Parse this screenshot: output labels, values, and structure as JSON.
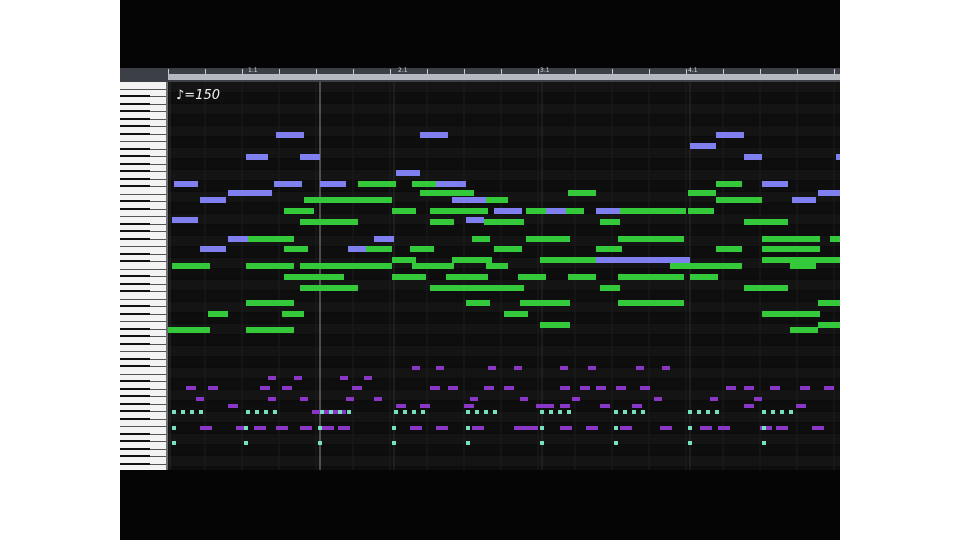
{
  "app": {
    "tempo_label": "♪=150"
  },
  "measure_labels": [
    "1.1",
    "2.1",
    "3.1",
    "4.1"
  ],
  "colors": {
    "melody": "#7f7ff0",
    "chords": "#34c93a",
    "bass": "#8a37c8",
    "drums": "#77e0c0"
  },
  "notes": {
    "melody": [
      [
        276,
        132,
        28,
        6
      ],
      [
        420,
        132,
        28,
        6
      ],
      [
        716,
        132,
        28,
        6
      ],
      [
        246,
        154,
        22,
        6
      ],
      [
        300,
        154,
        20,
        6
      ],
      [
        690,
        143,
        26,
        6
      ],
      [
        744,
        154,
        18,
        6
      ],
      [
        836,
        154,
        6,
        6
      ],
      [
        174,
        181,
        24,
        6
      ],
      [
        274,
        181,
        28,
        6
      ],
      [
        320,
        181,
        26,
        6
      ],
      [
        396,
        170,
        24,
        6
      ],
      [
        436,
        181,
        30,
        6
      ],
      [
        762,
        181,
        26,
        6
      ],
      [
        200,
        197,
        26,
        6
      ],
      [
        228,
        190,
        44,
        6
      ],
      [
        452,
        197,
        34,
        6
      ],
      [
        494,
        208,
        28,
        6
      ],
      [
        546,
        208,
        20,
        6
      ],
      [
        596,
        208,
        24,
        6
      ],
      [
        792,
        197,
        24,
        6
      ],
      [
        818,
        190,
        22,
        6
      ],
      [
        172,
        217,
        26,
        6
      ],
      [
        466,
        217,
        18,
        6
      ],
      [
        228,
        236,
        20,
        6
      ],
      [
        374,
        236,
        20,
        6
      ],
      [
        200,
        246,
        26,
        6
      ],
      [
        348,
        246,
        18,
        6
      ],
      [
        596,
        257,
        94,
        6
      ]
    ],
    "chords": [
      [
        358,
        181,
        38,
        6
      ],
      [
        412,
        181,
        26,
        6
      ],
      [
        716,
        181,
        26,
        6
      ],
      [
        304,
        197,
        88,
        6
      ],
      [
        420,
        190,
        54,
        6
      ],
      [
        474,
        197,
        34,
        6
      ],
      [
        568,
        190,
        28,
        6
      ],
      [
        688,
        190,
        28,
        6
      ],
      [
        716,
        197,
        46,
        6
      ],
      [
        284,
        208,
        30,
        6
      ],
      [
        392,
        208,
        24,
        6
      ],
      [
        430,
        208,
        58,
        6
      ],
      [
        526,
        208,
        58,
        6
      ],
      [
        598,
        208,
        88,
        6
      ],
      [
        688,
        208,
        26,
        6
      ],
      [
        300,
        219,
        58,
        6
      ],
      [
        430,
        219,
        24,
        6
      ],
      [
        484,
        219,
        40,
        6
      ],
      [
        600,
        219,
        20,
        6
      ],
      [
        744,
        219,
        18,
        6
      ],
      [
        762,
        219,
        26,
        6
      ],
      [
        246,
        236,
        48,
        6
      ],
      [
        472,
        236,
        18,
        6
      ],
      [
        526,
        236,
        44,
        6
      ],
      [
        618,
        236,
        66,
        6
      ],
      [
        762,
        236,
        58,
        6
      ],
      [
        284,
        246,
        24,
        6
      ],
      [
        348,
        246,
        44,
        6
      ],
      [
        410,
        246,
        24,
        6
      ],
      [
        494,
        246,
        28,
        6
      ],
      [
        596,
        246,
        26,
        6
      ],
      [
        716,
        246,
        26,
        6
      ],
      [
        762,
        246,
        58,
        6
      ],
      [
        830,
        236,
        12,
        6
      ],
      [
        172,
        263,
        38,
        6
      ],
      [
        246,
        263,
        48,
        6
      ],
      [
        300,
        263,
        92,
        6
      ],
      [
        392,
        257,
        24,
        6
      ],
      [
        412,
        263,
        42,
        6
      ],
      [
        452,
        257,
        40,
        6
      ],
      [
        486,
        263,
        22,
        6
      ],
      [
        540,
        257,
        56,
        6
      ],
      [
        670,
        263,
        46,
        6
      ],
      [
        716,
        263,
        26,
        6
      ],
      [
        762,
        257,
        58,
        6
      ],
      [
        790,
        263,
        26,
        6
      ],
      [
        818,
        257,
        24,
        6
      ],
      [
        284,
        274,
        20,
        6
      ],
      [
        304,
        274,
        40,
        6
      ],
      [
        392,
        274,
        34,
        6
      ],
      [
        446,
        274,
        42,
        6
      ],
      [
        518,
        274,
        28,
        6
      ],
      [
        568,
        274,
        28,
        6
      ],
      [
        618,
        274,
        66,
        6
      ],
      [
        690,
        274,
        28,
        6
      ],
      [
        300,
        285,
        58,
        6
      ],
      [
        430,
        285,
        58,
        6
      ],
      [
        484,
        285,
        40,
        6
      ],
      [
        600,
        285,
        20,
        6
      ],
      [
        744,
        285,
        18,
        6
      ],
      [
        762,
        285,
        26,
        6
      ],
      [
        246,
        300,
        48,
        6
      ],
      [
        466,
        300,
        24,
        6
      ],
      [
        520,
        300,
        50,
        6
      ],
      [
        618,
        300,
        66,
        6
      ],
      [
        818,
        300,
        22,
        6
      ],
      [
        208,
        311,
        20,
        6
      ],
      [
        282,
        311,
        22,
        6
      ],
      [
        504,
        311,
        24,
        6
      ],
      [
        762,
        311,
        58,
        6
      ],
      [
        168,
        327,
        42,
        6
      ],
      [
        246,
        327,
        48,
        6
      ],
      [
        540,
        322,
        30,
        6
      ],
      [
        790,
        327,
        28,
        6
      ],
      [
        818,
        322,
        22,
        6
      ]
    ],
    "bass": [
      [
        268,
        376,
        8,
        4
      ],
      [
        294,
        376,
        8,
        4
      ],
      [
        340,
        376,
        8,
        4
      ],
      [
        364,
        376,
        8,
        4
      ],
      [
        412,
        366,
        8,
        4
      ],
      [
        436,
        366,
        8,
        4
      ],
      [
        488,
        366,
        8,
        4
      ],
      [
        514,
        366,
        8,
        4
      ],
      [
        560,
        366,
        8,
        4
      ],
      [
        588,
        366,
        8,
        4
      ],
      [
        636,
        366,
        8,
        4
      ],
      [
        662,
        366,
        8,
        4
      ],
      [
        186,
        386,
        10,
        4
      ],
      [
        208,
        386,
        10,
        4
      ],
      [
        260,
        386,
        10,
        4
      ],
      [
        282,
        386,
        10,
        4
      ],
      [
        352,
        386,
        10,
        4
      ],
      [
        430,
        386,
        10,
        4
      ],
      [
        448,
        386,
        10,
        4
      ],
      [
        484,
        386,
        10,
        4
      ],
      [
        504,
        386,
        10,
        4
      ],
      [
        560,
        386,
        10,
        4
      ],
      [
        580,
        386,
        10,
        4
      ],
      [
        596,
        386,
        10,
        4
      ],
      [
        616,
        386,
        10,
        4
      ],
      [
        640,
        386,
        10,
        4
      ],
      [
        726,
        386,
        10,
        4
      ],
      [
        744,
        386,
        10,
        4
      ],
      [
        770,
        386,
        10,
        4
      ],
      [
        800,
        386,
        10,
        4
      ],
      [
        824,
        386,
        10,
        4
      ],
      [
        196,
        397,
        8,
        4
      ],
      [
        268,
        397,
        8,
        4
      ],
      [
        300,
        397,
        8,
        4
      ],
      [
        346,
        397,
        8,
        4
      ],
      [
        374,
        397,
        8,
        4
      ],
      [
        470,
        397,
        8,
        4
      ],
      [
        520,
        397,
        8,
        4
      ],
      [
        572,
        397,
        8,
        4
      ],
      [
        654,
        397,
        8,
        4
      ],
      [
        710,
        397,
        8,
        4
      ],
      [
        754,
        397,
        8,
        4
      ],
      [
        228,
        404,
        10,
        4
      ],
      [
        312,
        410,
        34,
        4
      ],
      [
        396,
        404,
        10,
        4
      ],
      [
        420,
        404,
        10,
        4
      ],
      [
        464,
        404,
        10,
        4
      ],
      [
        536,
        404,
        18,
        4
      ],
      [
        560,
        404,
        10,
        4
      ],
      [
        600,
        404,
        10,
        4
      ],
      [
        632,
        404,
        10,
        4
      ],
      [
        744,
        404,
        10,
        4
      ],
      [
        796,
        404,
        10,
        4
      ],
      [
        200,
        426,
        12,
        4
      ],
      [
        236,
        426,
        12,
        4
      ],
      [
        254,
        426,
        12,
        4
      ],
      [
        276,
        426,
        12,
        4
      ],
      [
        300,
        426,
        12,
        4
      ],
      [
        322,
        426,
        12,
        4
      ],
      [
        338,
        426,
        12,
        4
      ],
      [
        410,
        426,
        12,
        4
      ],
      [
        436,
        426,
        12,
        4
      ],
      [
        472,
        426,
        12,
        4
      ],
      [
        514,
        426,
        12,
        4
      ],
      [
        526,
        426,
        12,
        4
      ],
      [
        560,
        426,
        12,
        4
      ],
      [
        586,
        426,
        12,
        4
      ],
      [
        620,
        426,
        12,
        4
      ],
      [
        660,
        426,
        12,
        4
      ],
      [
        700,
        426,
        12,
        4
      ],
      [
        718,
        426,
        12,
        4
      ],
      [
        760,
        426,
        12,
        4
      ],
      [
        776,
        426,
        12,
        4
      ],
      [
        812,
        426,
        12,
        4
      ]
    ],
    "drums_rows": [
      [
        172,
        410,
        4,
        4,
        36
      ],
      [
        172,
        426,
        4,
        4,
        4
      ],
      [
        172,
        441,
        4,
        4,
        4
      ],
      [
        246,
        410,
        4,
        4,
        36
      ],
      [
        244,
        426,
        4,
        4,
        4
      ],
      [
        244,
        441,
        4,
        4,
        4
      ],
      [
        320,
        410,
        4,
        4,
        36
      ],
      [
        318,
        426,
        4,
        4,
        4
      ],
      [
        318,
        441,
        4,
        4,
        4
      ],
      [
        394,
        410,
        4,
        4,
        36
      ],
      [
        392,
        426,
        4,
        4,
        4
      ],
      [
        392,
        441,
        4,
        4,
        4
      ],
      [
        466,
        410,
        4,
        4,
        36
      ],
      [
        466,
        426,
        4,
        4,
        4
      ],
      [
        466,
        441,
        4,
        4,
        4
      ],
      [
        540,
        410,
        4,
        4,
        36
      ],
      [
        540,
        426,
        4,
        4,
        4
      ],
      [
        540,
        441,
        4,
        4,
        4
      ],
      [
        614,
        410,
        4,
        4,
        36
      ],
      [
        614,
        426,
        4,
        4,
        4
      ],
      [
        614,
        441,
        4,
        4,
        4
      ],
      [
        688,
        410,
        4,
        4,
        36
      ],
      [
        688,
        426,
        4,
        4,
        4
      ],
      [
        688,
        441,
        4,
        4,
        4
      ],
      [
        762,
        410,
        4,
        4,
        36
      ],
      [
        762,
        426,
        4,
        4,
        4
      ],
      [
        762,
        441,
        4,
        4,
        4
      ]
    ]
  }
}
